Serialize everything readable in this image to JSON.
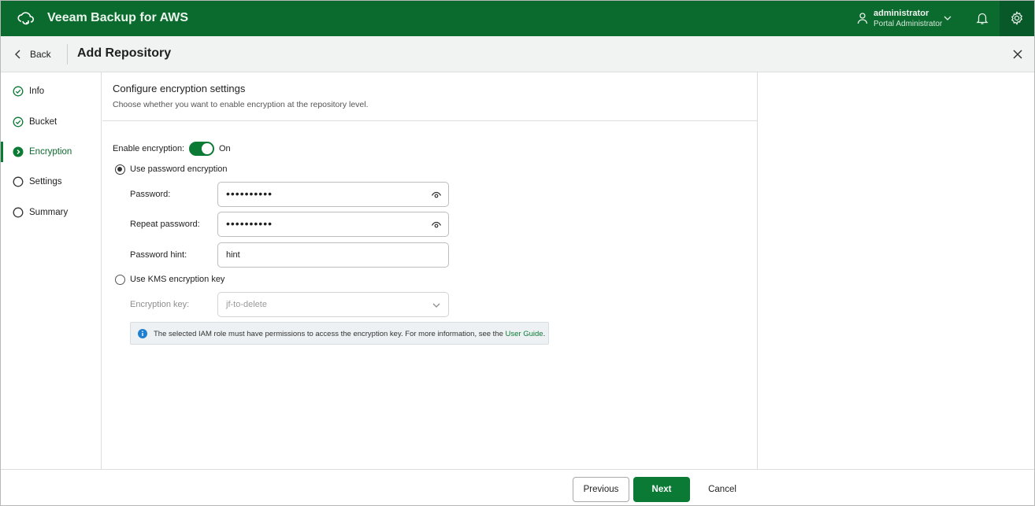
{
  "app": {
    "title": "Veeam Backup for AWS",
    "brand_color": "#0b6b2e",
    "icon": "cloud-backup-icon"
  },
  "user": {
    "name": "administrator",
    "role": "Portal Administrator"
  },
  "header": {
    "back_label": "Back",
    "title": "Add Repository"
  },
  "steps": [
    {
      "label": "Info",
      "state": "done"
    },
    {
      "label": "Bucket",
      "state": "done"
    },
    {
      "label": "Encryption",
      "state": "active"
    },
    {
      "label": "Settings",
      "state": "pending"
    },
    {
      "label": "Summary",
      "state": "pending"
    }
  ],
  "section": {
    "title": "Configure encryption settings",
    "description": "Choose whether you want to enable encryption at the repository level."
  },
  "encryption": {
    "enable_label": "Enable encryption:",
    "enabled": true,
    "state_text": "On",
    "password_option": {
      "label": "Use password encryption",
      "selected": true,
      "password_label": "Password:",
      "password_value": "••••••••••",
      "repeat_label": "Repeat password:",
      "repeat_value": "••••••••••",
      "hint_label": "Password hint:",
      "hint_value": "hint"
    },
    "kms_option": {
      "label": "Use KMS encryption key",
      "selected": false,
      "key_label": "Encryption key:",
      "key_value": "jf-to-delete"
    },
    "info": {
      "text": "The selected IAM role must have permissions to access the encryption key. For more information, see the",
      "link": "User Guide",
      "suffix": "."
    }
  },
  "footer": {
    "previous": "Previous",
    "next": "Next",
    "cancel": "Cancel"
  }
}
